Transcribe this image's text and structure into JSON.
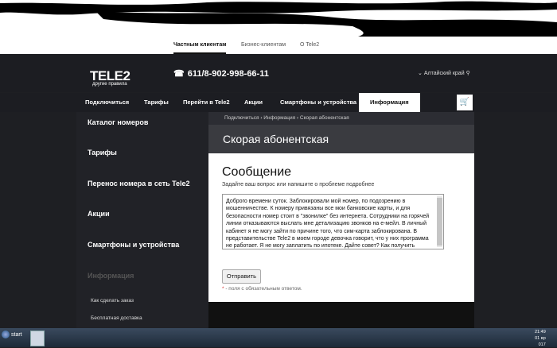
{
  "topbar": {
    "tabs": [
      {
        "label": "Частным клиентам",
        "active": true
      },
      {
        "label": "Бизнес-клиентам",
        "active": false
      },
      {
        "label": "О Tele2",
        "active": false
      }
    ]
  },
  "header": {
    "logo": "TELE2",
    "slogan": "другие правила",
    "phone": "611/8-902-998-66-11",
    "region": "Алтайский край"
  },
  "nav": {
    "items": [
      {
        "label": "Подключиться"
      },
      {
        "label": "Тарифы"
      },
      {
        "label": "Перейти в Tele2"
      },
      {
        "label": "Акции"
      },
      {
        "label": "Смартфоны и устройства"
      },
      {
        "label": "Информация"
      }
    ]
  },
  "sidebar": {
    "items": [
      {
        "label": "Каталог номеров"
      },
      {
        "label": "Тарифы"
      },
      {
        "label": "Перенос номера в сеть Tele2"
      },
      {
        "label": "Акции"
      },
      {
        "label": "Смартфоны и устройства"
      },
      {
        "label": "Информация"
      }
    ],
    "subitems": [
      {
        "label": "Как сделать заказ"
      },
      {
        "label": "Бесплатная доставка"
      }
    ]
  },
  "breadcrumb": "Подключиться  › Информация  › Скорая абонентская",
  "page": {
    "title": "Скорая абонентская",
    "section_title": "Сообщение",
    "hint": "Задайте ваш вопрос или напишите о проблеме подробнее",
    "message": "Доброго времени суток. Заблокировали мой номер, по подозрению в мошенничестве. К номеру привязаны все мои банковские карты, и для безопасности номер стоит в \"звонилке\" без интернета. Сотрудники на горячей линии отказываются выслать мне детализацию звонков на е-мейл. В личный кабинет я не могу зайти по причине того, что сим-карта заблокирована. В представительстве Tele2 в моем городе девочка говорит, что у них программа не работает. Я не могу заплатить по ипотеке. Дайте совет? Как получить распечатку о действиях с моей симкартой, чтобы потом",
    "send_label": "Отправить",
    "required_star": "*",
    "required_note": " - поля с обязательным ответом."
  },
  "taskbar": {
    "start": "start",
    "time": "21:49",
    "date": "01 вр",
    "year": "017"
  }
}
